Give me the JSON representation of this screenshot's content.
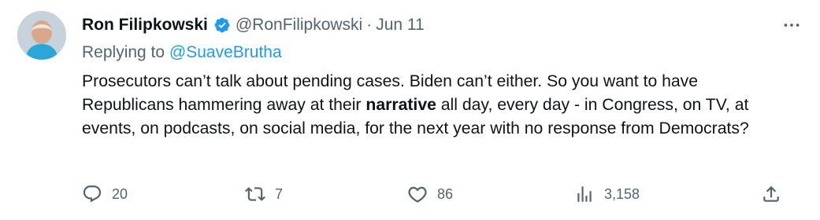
{
  "tweet": {
    "author_name": "Ron Filipkowski",
    "handle": "@RonFilipkowski",
    "separator": "·",
    "date": "Jun 11",
    "replying_prefix": "Replying to ",
    "replying_to": "@SuaveBrutha",
    "text_part1": "Prosecutors can’t talk about pending cases. Biden can’t either. So you want to have Republicans hammering away at their ",
    "text_bold": "narrative",
    "text_part2": " all day, every day - in Congress, on TV, at events, on podcasts, on social media, for the next year with no response from Democrats?",
    "verified": true
  },
  "actions": {
    "replies": "20",
    "reposts": "7",
    "likes": "86",
    "views": "3,158"
  },
  "icons": {
    "verified": "verified-badge-icon",
    "more": "more-options-icon",
    "reply": "reply-bubble-icon",
    "repost": "repost-arrows-icon",
    "like": "heart-icon",
    "views": "views-bar-chart-icon",
    "share": "share-upload-icon"
  },
  "colors": {
    "text": "#0f1419",
    "secondary": "#536471",
    "link": "#1d9bf0",
    "verified": "#1d9bf0"
  }
}
